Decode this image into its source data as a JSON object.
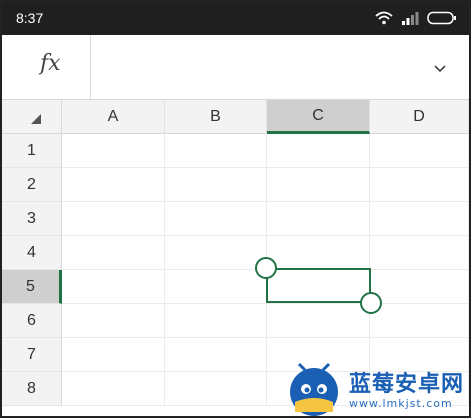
{
  "status_bar": {
    "time": "8:37"
  },
  "formula_bar": {
    "fx_label": "fx",
    "value": ""
  },
  "columns": [
    "A",
    "B",
    "C",
    "D"
  ],
  "selected_column": "C",
  "rows": [
    "1",
    "2",
    "3",
    "4",
    "5",
    "6",
    "7",
    "8"
  ],
  "selected_row": "5",
  "watermark": {
    "brand": "蓝莓安卓网",
    "url": "www.lmkjst.com"
  },
  "colors": {
    "accent": "#217346",
    "header_bg": "#f3f3f3",
    "header_selected_bg": "#cfcfcf",
    "status_bar": "#1f1f1f"
  }
}
